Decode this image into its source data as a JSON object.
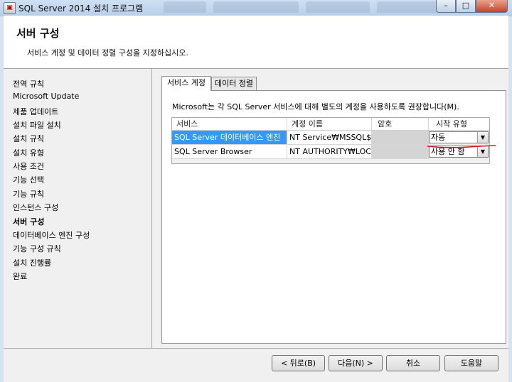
{
  "window": {
    "title": "SQL Server 2014 설치 프로그램",
    "buttons": {
      "minimize": "–",
      "maximize": "□",
      "close": "✕"
    }
  },
  "header": {
    "title": "서버 구성",
    "subtitle": "서비스 계정 및 데이터 정렬 구성을 지정하십시오."
  },
  "nav": {
    "items": [
      {
        "label": "전역 규칙"
      },
      {
        "label": "Microsoft Update"
      },
      {
        "label": "제품 업데이트"
      },
      {
        "label": "설치 파일 설치"
      },
      {
        "label": "설치 규칙"
      },
      {
        "label": "설치 유형"
      },
      {
        "label": "사용 조건"
      },
      {
        "label": "기능 선택"
      },
      {
        "label": "기능 규칙"
      },
      {
        "label": "인스턴스 구성"
      },
      {
        "label": "서버 구성",
        "active": true
      },
      {
        "label": "데이터베이스 엔진 구성"
      },
      {
        "label": "기능 구성 규칙"
      },
      {
        "label": "설치 진행률"
      },
      {
        "label": "완료"
      }
    ]
  },
  "tabs": [
    {
      "label": "서비스 계정",
      "active": true
    },
    {
      "label": "데이터 정렬",
      "active": false
    }
  ],
  "description": "Microsoft는 각 SQL Server 서비스에 대해 별도의 계정을 사용하도록 권장합니다(M).",
  "table": {
    "columns": [
      "서비스",
      "계정 이름",
      "암호",
      "시작 유형"
    ],
    "rows": [
      {
        "service": "SQL Server 데이터베이스 엔진",
        "account": "NT Service₩MSSQL$...",
        "password": "",
        "startup": "자동"
      },
      {
        "service": "SQL Server Browser",
        "account": "NT AUTHORITY₩LOC...",
        "password": "",
        "startup": "사용 안 함"
      }
    ]
  },
  "footer": {
    "back": "< 뒤로(B)",
    "next": "다음(N) >",
    "cancel": "취소",
    "help": "도움말"
  },
  "colors": {
    "selection": "#3399ff",
    "annotation": "#d81b1b"
  }
}
